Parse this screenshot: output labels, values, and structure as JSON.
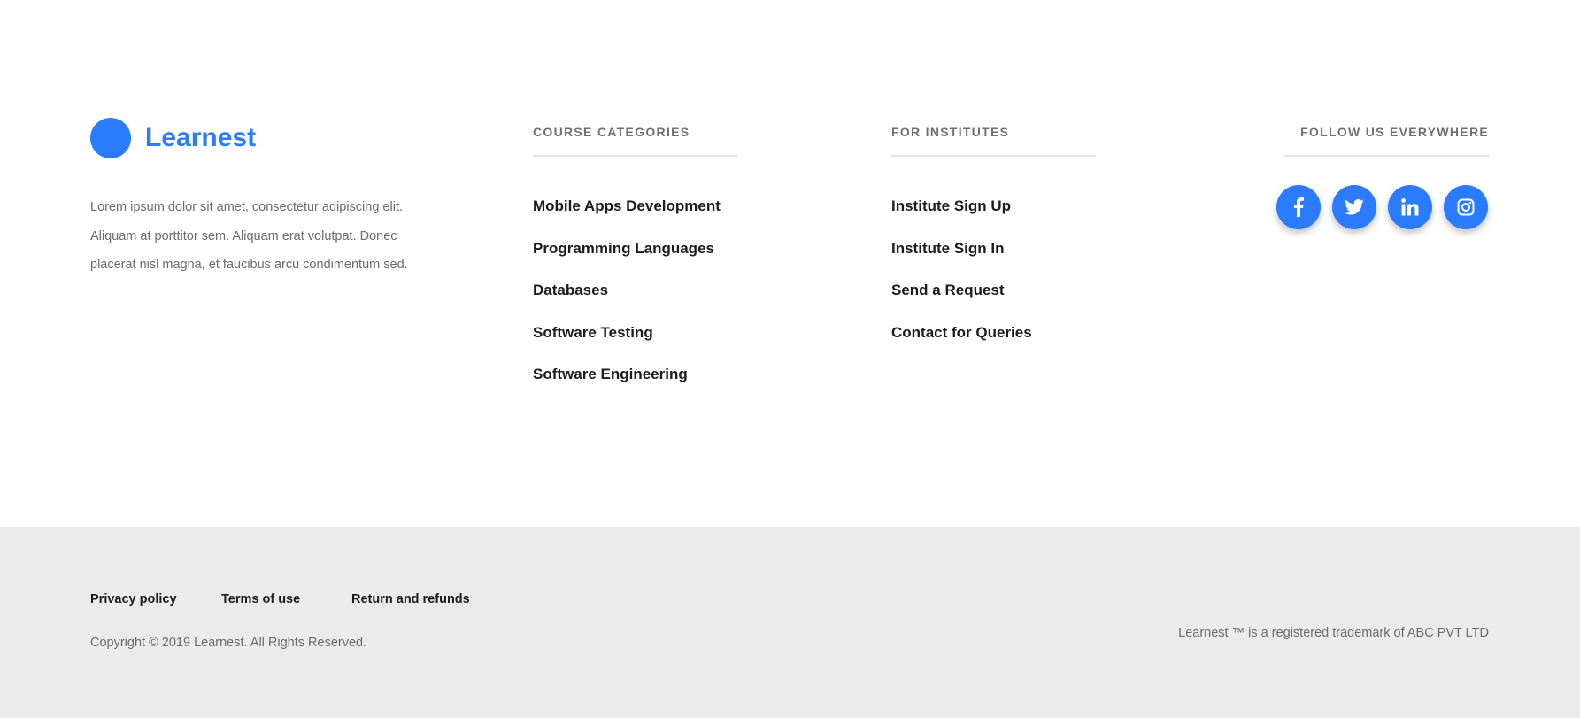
{
  "brand": {
    "name": "Learnest",
    "color": "#2b7bff"
  },
  "about": "Lorem ipsum dolor sit amet, consectetur adipiscing elit. Aliquam at porttitor sem.  Aliquam erat volutpat. Donec placerat nisl magna, et faucibus arcu condimentum sed.",
  "course_categories": {
    "title": "COURSE CATEGORIES",
    "items": [
      "Mobile Apps Development",
      "Programming Languages",
      "Databases",
      "Software Testing",
      "Software Engineering"
    ]
  },
  "institutes": {
    "title": "FOR INSTITUTES",
    "items": [
      "Institute Sign Up",
      "Institute Sign In",
      "Send a Request",
      "Contact for Queries"
    ]
  },
  "follow": {
    "title": "FOLLOW US EVERYWHERE",
    "icons": [
      "facebook-icon",
      "twitter-icon",
      "linkedin-icon",
      "instagram-icon"
    ]
  },
  "bottom": {
    "links": [
      "Privacy policy",
      "Terms of use",
      "Return and refunds"
    ],
    "copyright": "Copyright © 2019 Learnest. All Rights Reserved.",
    "trademark": "Learnest ™ is a registered trademark of ABC PVT LTD"
  }
}
